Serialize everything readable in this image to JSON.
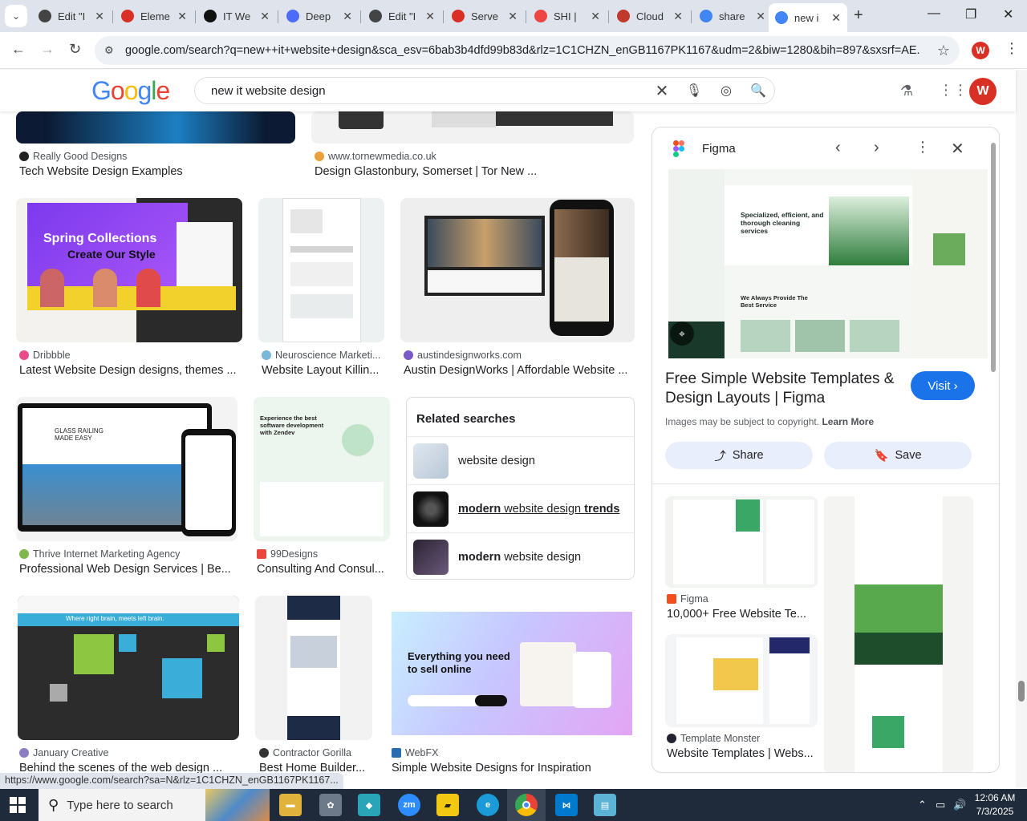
{
  "browser": {
    "tabs": [
      {
        "title": "Edit \"I",
        "fav": "#444"
      },
      {
        "title": "Eleme",
        "fav": "#d93025"
      },
      {
        "title": "IT We",
        "fav": "#111"
      },
      {
        "title": "Deep",
        "fav": "#4a6cf7"
      },
      {
        "title": "Edit \"I",
        "fav": "#444"
      },
      {
        "title": "Serve",
        "fav": "#d93025"
      },
      {
        "title": "SHI |",
        "fav": "#e44"
      },
      {
        "title": "Cloud",
        "fav": "#c0392b"
      },
      {
        "title": "share",
        "fav": "#4285f4"
      },
      {
        "title": "new i",
        "fav": "#4285f4",
        "active": true
      }
    ],
    "url": "google.com/search?q=new++it+website+design&sca_esv=6bab3b4dfd99b83d&rlz=1C1CHZN_enGB1167PK1167&udm=2&biw=1280&bih=897&sxsrf=AE...",
    "profile_initial": "W"
  },
  "google": {
    "logo": "Google",
    "query": "new it website design",
    "avatar_initial": "W"
  },
  "results": {
    "row0": [
      {
        "source": "Really Good Designs",
        "title": "Tech Website Design Examples"
      },
      {
        "source": "www.tornewmedia.co.uk",
        "title": "Design Glastonbury, Somerset | Tor New ..."
      }
    ],
    "row1": [
      {
        "source": "Dribbble",
        "title": "Latest Website Design designs, themes ..."
      },
      {
        "source": "Neuroscience Marketi...",
        "title": "Website Layout Killin..."
      },
      {
        "source": "austindesignworks.com",
        "title": "Austin DesignWorks | Affordable Website ..."
      }
    ],
    "row2": [
      {
        "source": "Thrive Internet Marketing Agency",
        "title": "Professional Web Design Services | Be..."
      },
      {
        "source": "99Designs",
        "title": "Consulting And Consul..."
      }
    ],
    "row3": [
      {
        "source": "January Creative",
        "title": "Behind the scenes of the web design ..."
      },
      {
        "source": "Contractor Gorilla",
        "title": "Best Home Builder..."
      },
      {
        "source": "WebFX",
        "title": "Simple Website Designs for Inspiration"
      }
    ],
    "thumb_text": {
      "spring1": "Spring Collections",
      "spring2": "Create Our Style",
      "glass": "GLASS RAILING MADE EASY",
      "zendev": "Experience the best software development with Zendev",
      "jan": "Where right brain, meets left brain.",
      "shopify1": "Everything you need",
      "shopify2": "to sell online"
    }
  },
  "related": {
    "heading": "Related searches",
    "items": [
      {
        "pre": "",
        "bold": "",
        "plain": "website design",
        "post": ""
      },
      {
        "pre": "modern",
        "plain": " website design ",
        "bold": "trends",
        "underline": true
      },
      {
        "pre": "modern",
        "plain": " website design",
        "bold": ""
      }
    ]
  },
  "panel": {
    "source": "Figma",
    "title": "Free Simple Website Templates & Design Layouts | Figma",
    "visit": "Visit",
    "copyright": "Images may be subject to copyright.",
    "learn_more": "Learn More",
    "share": "Share",
    "save": "Save",
    "img_headline": "Specialized, efficient, and thorough cleaning services",
    "img_sub": "We Always Provide The Best Service",
    "more": [
      {
        "source": "Figma",
        "title": "10,000+ Free Website Te..."
      },
      {
        "source": "Template Monster",
        "title": "Website Templates | Webs..."
      }
    ]
  },
  "status_url": "https://www.google.com/search?sa=N&rlz=1C1CHZN_enGB1167PK1167...",
  "taskbar": {
    "search_placeholder": "Type here to search",
    "time": "12:06 AM",
    "date": "7/3/2025"
  }
}
